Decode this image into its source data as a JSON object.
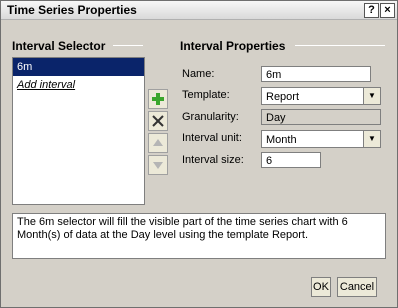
{
  "window": {
    "title": "Time Series Properties",
    "help_glyph": "?",
    "close_glyph": "×"
  },
  "left": {
    "heading": "Interval Selector",
    "items": [
      {
        "label": "6m",
        "selected": true
      },
      {
        "label": "Add interval",
        "selected": false
      }
    ]
  },
  "right": {
    "heading": "Interval Properties",
    "name": {
      "label": "Name:",
      "value": "6m"
    },
    "template": {
      "label": "Template:",
      "value": "Report"
    },
    "granularity": {
      "label": "Granularity:",
      "value": "Day"
    },
    "interval_unit": {
      "label": "Interval unit:",
      "value": "Month"
    },
    "interval_size": {
      "label": "Interval size:",
      "value": "6"
    }
  },
  "side_buttons": [
    "add-icon",
    "delete-icon",
    "move-up-icon",
    "move-down-icon"
  ],
  "description": "The 6m selector will fill the visible part of the time series chart with 6 Month(s) of data at the Day level using the template Report.",
  "footer": {
    "ok": "OK",
    "cancel": "Cancel"
  },
  "colors": {
    "selection": "#0a246a",
    "add": "#3aa62c",
    "window_bg": "#d4d0c8"
  }
}
